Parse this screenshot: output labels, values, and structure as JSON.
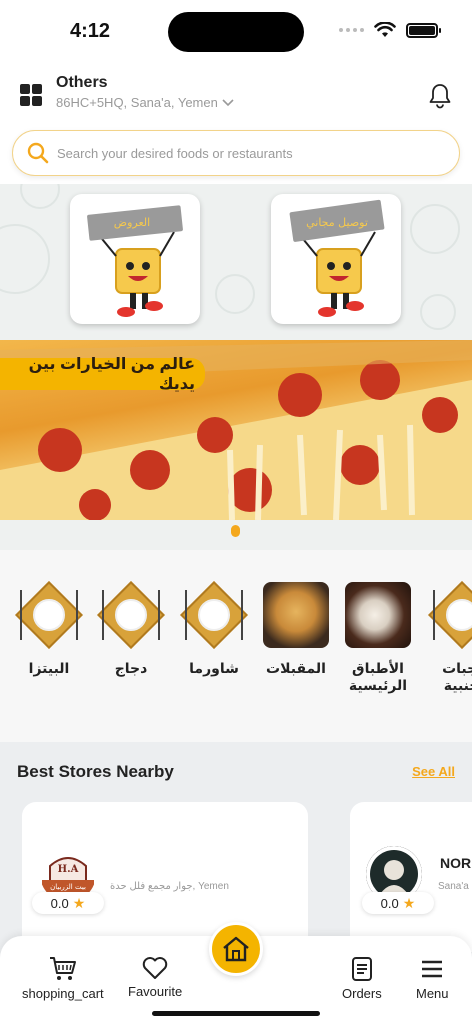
{
  "status_bar": {
    "time": "4:12"
  },
  "header": {
    "location_title": "Others",
    "location_address": "86HC+5HQ, Sana'a, Yemen",
    "search_placeholder": "Search your desired foods or restaurants"
  },
  "banner": {
    "promo_cards": [
      {
        "label": "العروض",
        "icon": "offers-mascot-icon"
      },
      {
        "label": "توصيل مجاني",
        "icon": "free-delivery-mascot-icon"
      }
    ],
    "slogan": "عالم من الخيارات بين يديك",
    "active_page": 1,
    "page_count": 1
  },
  "categories": [
    {
      "label": "البيتزا",
      "type": "plate"
    },
    {
      "label": "دجاج",
      "type": "plate"
    },
    {
      "label": "شاورما",
      "type": "plate"
    },
    {
      "label": "المقبلات",
      "type": "photo"
    },
    {
      "label": "الأطباق الرئيسية",
      "type": "photo"
    },
    {
      "label": "وجبات أجنبية",
      "type": "plate"
    }
  ],
  "stores_section": {
    "title": "Best Stores Nearby",
    "see_all": "See All",
    "stores": [
      {
        "name": "",
        "logo_text": "بيت الزربيان",
        "logo_sub": "The House of Zurbian",
        "address": "Yemen ,جوار مجمع فلل حدة",
        "rating": "0.0"
      },
      {
        "name": "NOR",
        "address": "Sana'a",
        "rating": "0.0"
      }
    ]
  },
  "bottom_nav": {
    "cart": "shopping_cart",
    "favourite": "Favourite",
    "orders": "Orders",
    "menu": "Menu"
  },
  "colors": {
    "accent": "#f4b400",
    "link": "#f4a81d"
  }
}
